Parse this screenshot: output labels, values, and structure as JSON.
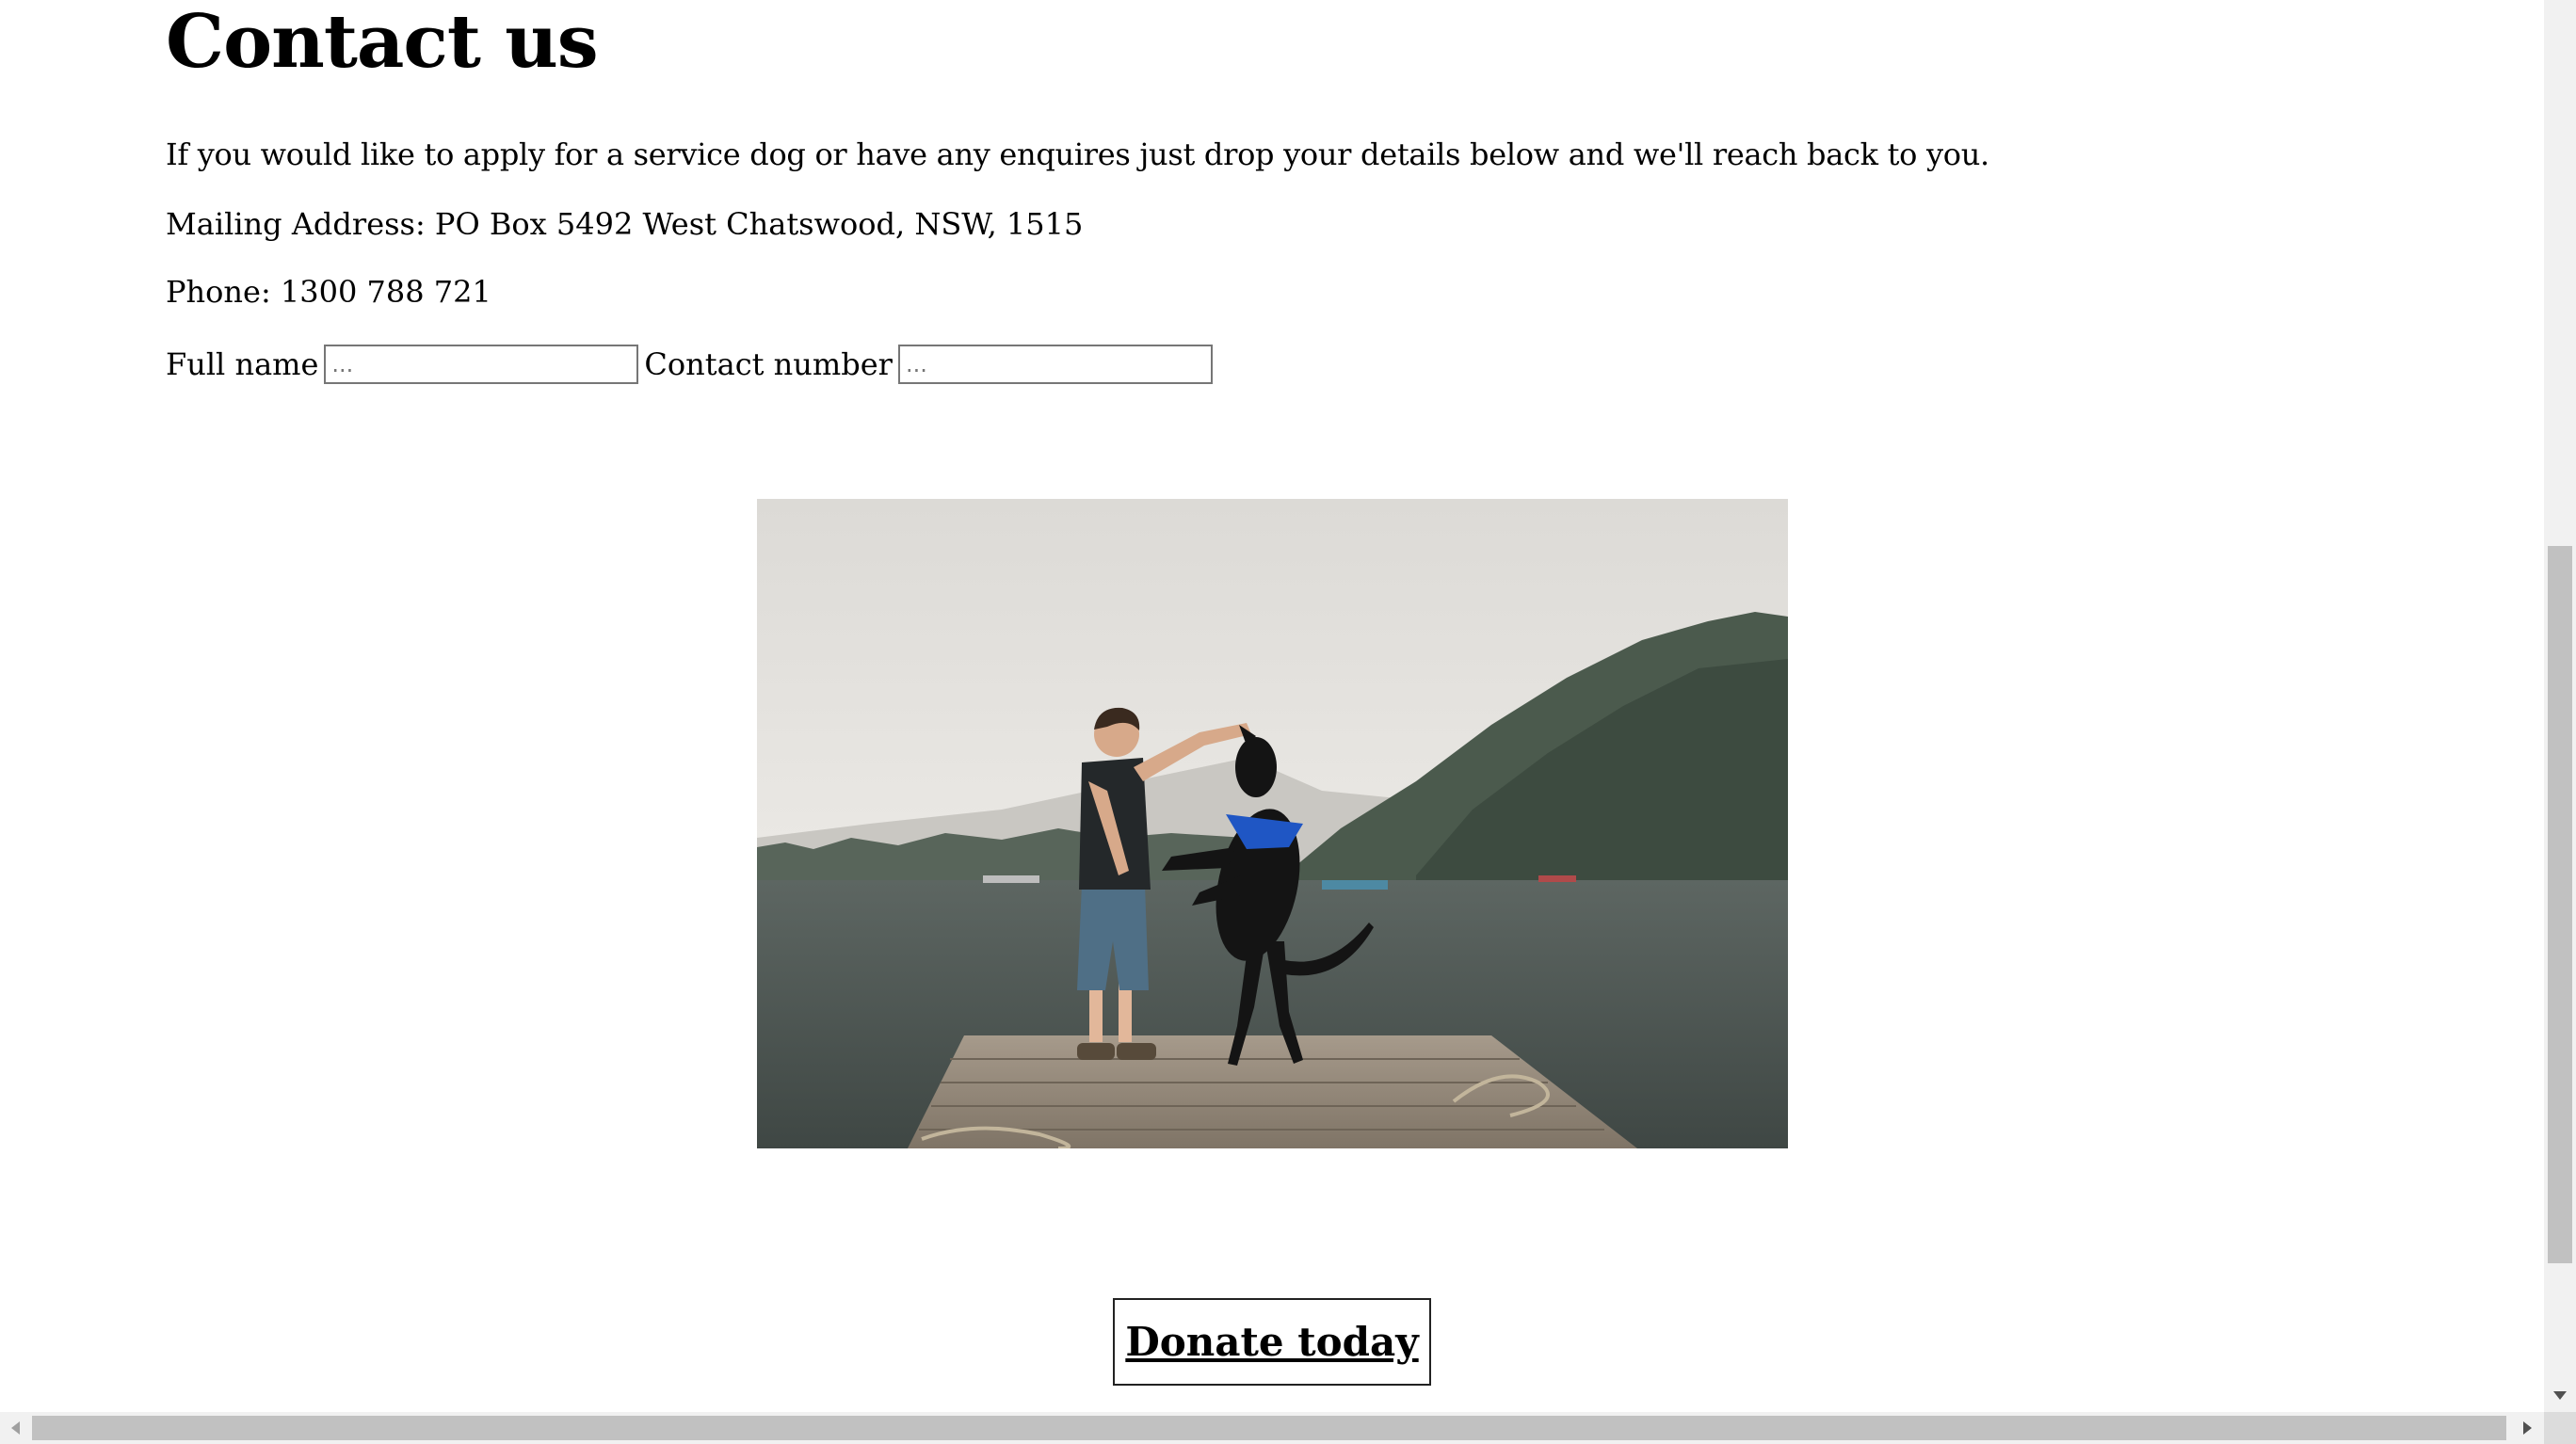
{
  "heading": "Contact us",
  "intro": "If you would like to apply for a service dog or have any enquires just drop your details below and we'll reach back to you.",
  "mailing_address": "Mailing Address: PO Box 5492 West Chatswood, NSW, 1515",
  "phone": "Phone: 1300 788 721",
  "form": {
    "full_name_label": "Full name",
    "full_name_placeholder": "...",
    "contact_number_label": "Contact number",
    "contact_number_placeholder": "..."
  },
  "image": {
    "icon": "photo-man-dog-dock"
  },
  "donate_label": "Donate today",
  "colors": {
    "text": "#000000",
    "background": "#ffffff",
    "scrollbar_track": "#f1f1f1",
    "scrollbar_thumb": "#c1c1c1"
  }
}
